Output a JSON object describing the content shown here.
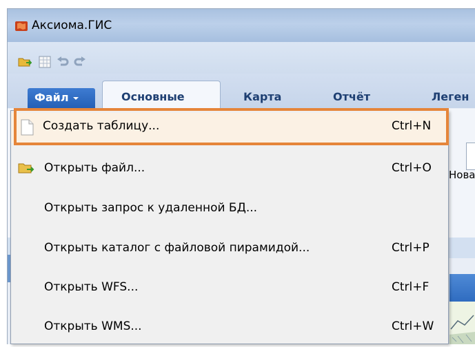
{
  "window": {
    "title": "Аксиома.ГИС",
    "colors": {
      "accent": "#e5853a",
      "file_tab": "#2f6cc0",
      "title_bar": "#b3c9e6"
    }
  },
  "quick_access": {
    "icons": [
      "open-folder-icon",
      "table-grid-icon",
      "undo-icon",
      "redo-icon"
    ]
  },
  "ribbon": {
    "tabs": {
      "file": "Файл",
      "main": "Основные",
      "map": "Карта",
      "report": "Отчёт",
      "legend": "Леген"
    },
    "partial_button_label": "Нова"
  },
  "file_menu": {
    "items": [
      {
        "label": "Создать таблицу...",
        "shortcut": "Ctrl+N",
        "icon": "blank-document-icon",
        "highlighted": true
      },
      {
        "label": "Открыть файл...",
        "shortcut": "Ctrl+O",
        "icon": "open-folder-icon"
      },
      {
        "label": "Открыть запрос к удаленной БД...",
        "shortcut": ""
      },
      {
        "label": "Открыть каталог с файловой пирамидой...",
        "shortcut": "Ctrl+P"
      },
      {
        "label": "Открыть WFS...",
        "shortcut": "Ctrl+F"
      },
      {
        "label": "Открыть WMS...",
        "shortcut": "Ctrl+W"
      }
    ]
  }
}
